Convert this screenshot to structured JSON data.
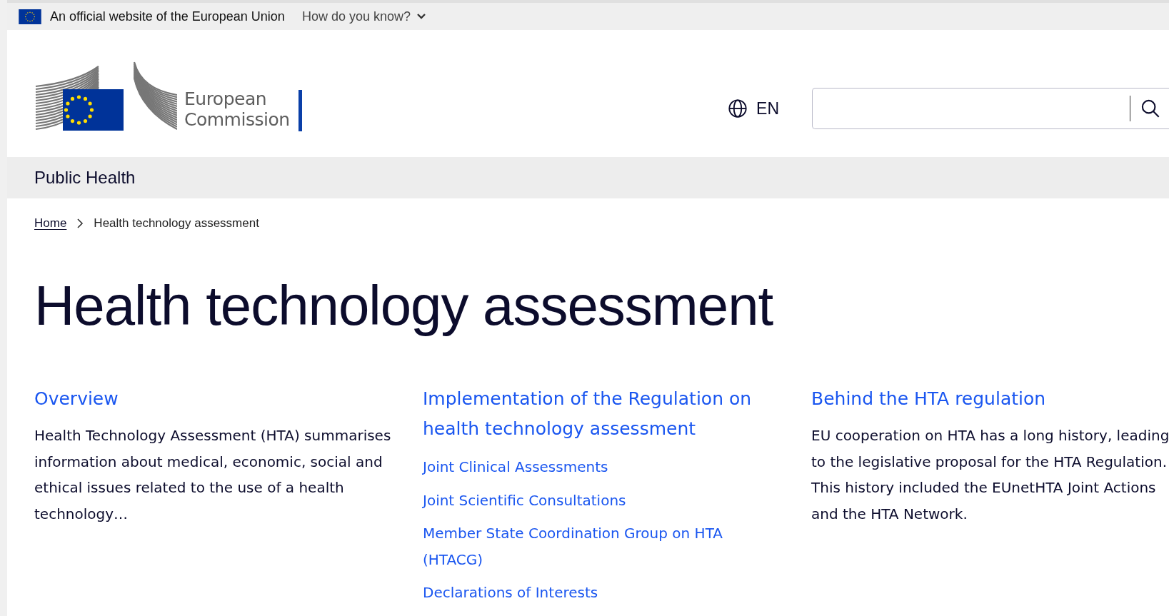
{
  "top_bar": {
    "text": "An official website of the European Union",
    "toggle": "How do you know?",
    "expanded": false
  },
  "header": {
    "logo_text": [
      "European",
      "Commission"
    ],
    "language": "EN"
  },
  "site_bar": {
    "title": "Public Health"
  },
  "breadcrumb": [
    {
      "label": "Home",
      "kind": "link"
    },
    {
      "label": "Health technology assessment",
      "kind": "current"
    }
  ],
  "page_title": "Health technology assessment",
  "columns": [
    {
      "heading": "Overview",
      "text": "Health Technology Assessment (HTA) summarises information about medical, economic, social and ethical issues related to the use of a health technology…"
    },
    {
      "heading": "Implementation of the Regulation on health technology assessment",
      "links": [
        "Joint Clinical Assessments",
        "Joint Scientific Consultations",
        "Member State Coordination Group on HTA (HTACG)",
        "Declarations of Interests"
      ]
    },
    {
      "heading": "Behind the HTA regulation",
      "text": "EU cooperation on HTA has a long history, leading to the legislative proposal for the HTA Regulation. This history included the EUnetHTA Joint Actions and the HTA Network."
    }
  ]
}
